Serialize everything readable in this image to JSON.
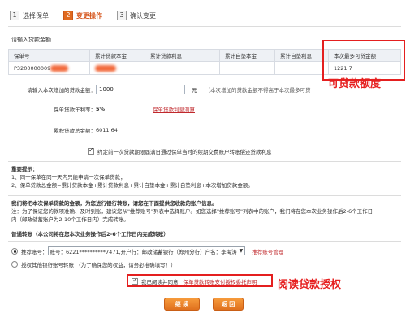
{
  "steps": [
    {
      "num": "1",
      "label": "选择保单"
    },
    {
      "num": "2",
      "label": "变更操作"
    },
    {
      "num": "3",
      "label": "确认变更"
    }
  ],
  "section_title": "请输入贷款金额",
  "table": {
    "headers": [
      "保单号",
      "累计贷款本金",
      "累计贷款利息",
      "累计自垫本金",
      "累计自垫利息",
      "本次最多可贷金额"
    ],
    "row": {
      "policy_no": "P3200000009",
      "max_amount": "1221.7"
    }
  },
  "annotations": {
    "loan_quota": "可贷款额度",
    "read_authorize": "阅读贷款授权"
  },
  "form": {
    "amount_label": "请输入本次增加的贷款金额：",
    "amount_value": "1000",
    "amount_unit": "元",
    "amount_hint": "（本次增加的贷款金额不得高于本次最多可贷",
    "rate_label": "保单贷款年利率：",
    "rate_value": "5%",
    "rate_link": "保单贷款利息测算",
    "total_label": "累积贷款总金额：",
    "total_value": "6011.64",
    "auto_repay_text": "约定前一次贷款期限届满日通过保单当时的续期交费账户转账偿还贷款利息"
  },
  "notice": {
    "title": "重要提示：",
    "line1": "1、同一保单在同一天内只能申请一次保单贷款；",
    "line2": "2、保单贷款总金额=累计贷款本金+累计贷款利息+累计自垫本金+累计自垫利息+本次增加贷款金额。"
  },
  "account": {
    "intro_bold": "我们将把本次保单贷款的金额，为您进行银行转账，请您在下面提供您收款的账户信息。",
    "intro_note1": "注：为了保证您的款项准确、及时到账，建议您从\"推荐账号\"列表中选择账户。如您选择\"推荐账号\"列表中的账户，我们将在您本次业务操作后2-6个工作日",
    "intro_note2": "内（邮政储蓄账户为2-10个工作日内）完成转账。",
    "transfer_title": "普通转账（本公司将在您本次业务操作后2-6个工作日内完成转账）",
    "recommended_label": "推荐账号：",
    "recommended_value": "账号：6221**********7471,开户行：邮政储蓄银行（郑州分行）户名：李海涛",
    "manage_link": "推荐账号管理",
    "other_account_text": "授权其他银行账号转账 （为了确保您的权益，请务必准确填写！）"
  },
  "agreement": {
    "checkbox_text": "我已阅读并同意",
    "link_text": "保单贷款转账支付授权委托声明"
  },
  "buttons": {
    "continue": "继 续",
    "back": "返 回"
  }
}
